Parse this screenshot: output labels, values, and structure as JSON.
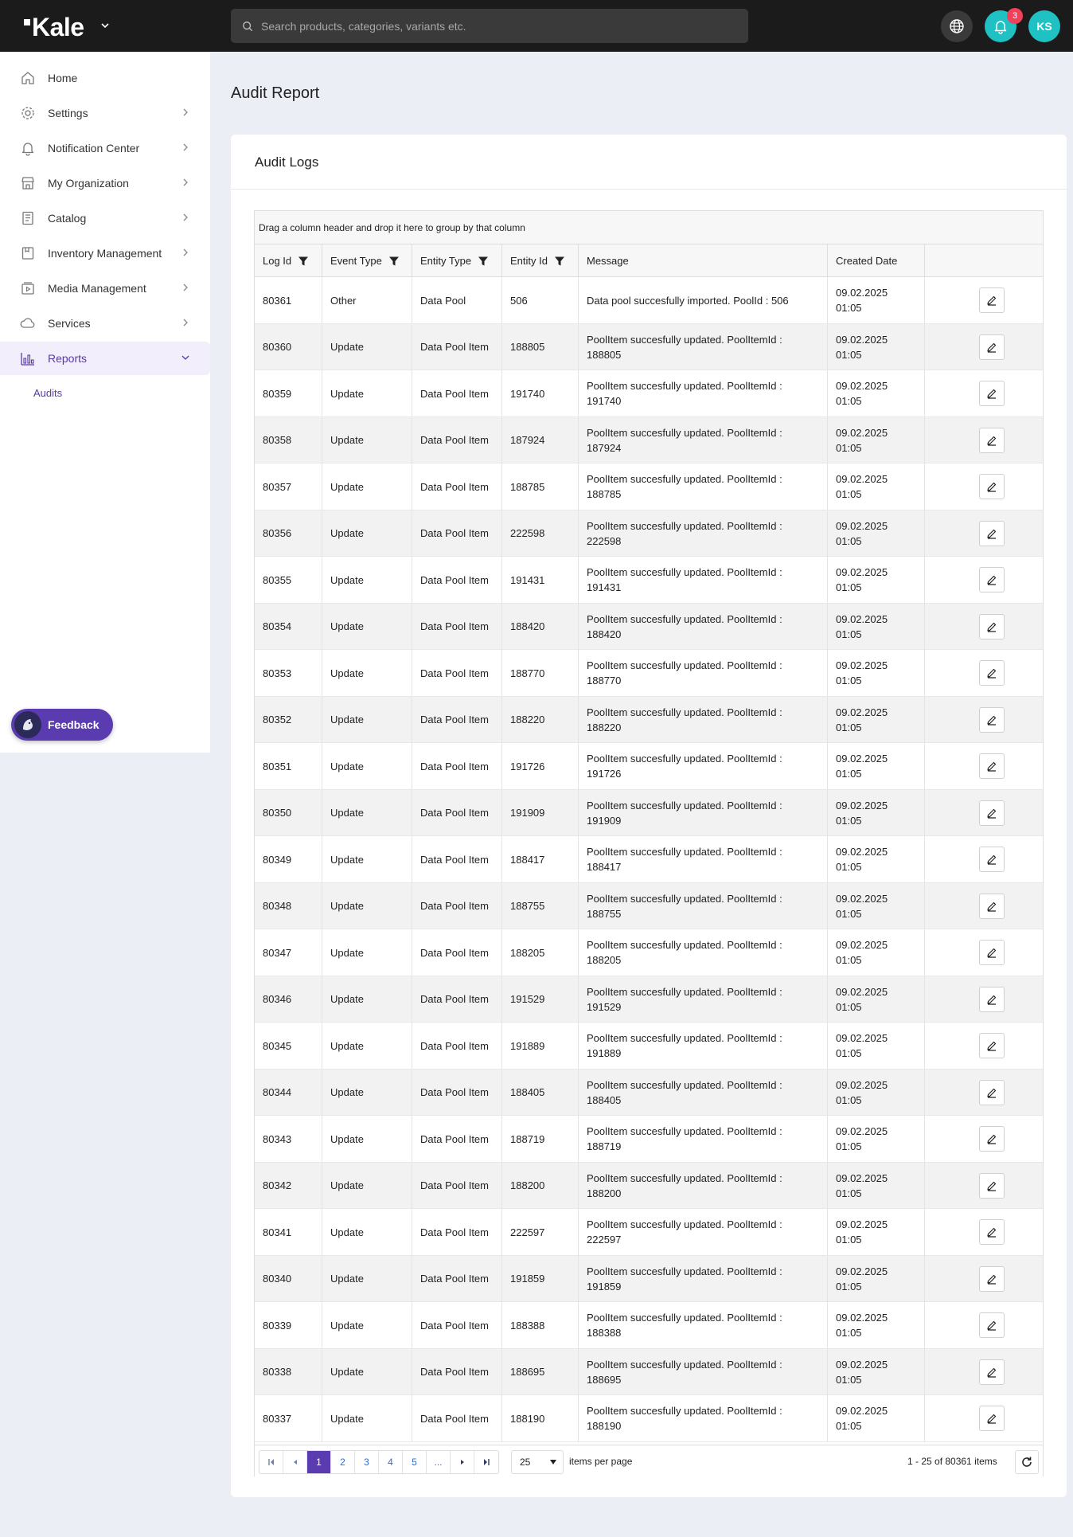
{
  "app": {
    "logo_text": "Kale"
  },
  "header": {
    "search_placeholder": "Search products, categories, variants etc.",
    "notification_count": "3",
    "user_initials": "KS"
  },
  "sidebar": {
    "items": [
      {
        "label": "Home",
        "icon": "home-icon",
        "has_chevron": false
      },
      {
        "label": "Settings",
        "icon": "gear-icon",
        "has_chevron": true
      },
      {
        "label": "Notification Center",
        "icon": "bell-icon",
        "has_chevron": true
      },
      {
        "label": "My Organization",
        "icon": "store-icon",
        "has_chevron": true
      },
      {
        "label": "Catalog",
        "icon": "catalog-icon",
        "has_chevron": true
      },
      {
        "label": "Inventory Management",
        "icon": "inventory-icon",
        "has_chevron": true
      },
      {
        "label": "Media Management",
        "icon": "media-icon",
        "has_chevron": true
      },
      {
        "label": "Services",
        "icon": "services-icon",
        "has_chevron": true
      },
      {
        "label": "Reports",
        "icon": "reports-icon",
        "has_chevron": true,
        "active": true
      }
    ],
    "sub_items": [
      {
        "label": "Audits"
      }
    ],
    "feedback_label": "Feedback"
  },
  "page": {
    "title": "Audit Report"
  },
  "card": {
    "title": "Audit Logs"
  },
  "grid": {
    "group_hint": "Drag a column header and drop it here to group by that column",
    "columns": [
      "Log Id",
      "Event Type",
      "Entity Type",
      "Entity Id",
      "Message",
      "Created Date"
    ],
    "rows": [
      {
        "log_id": "80361",
        "event": "Other",
        "entity_type": "Data Pool",
        "entity_id": "506",
        "message": "Data pool succesfully imported. PoolId : 506",
        "date": "09.02.2025 01:05"
      },
      {
        "log_id": "80360",
        "event": "Update",
        "entity_type": "Data Pool Item",
        "entity_id": "188805",
        "message": "PoolItem succesfully updated. PoolItemId : 188805",
        "date": "09.02.2025 01:05"
      },
      {
        "log_id": "80359",
        "event": "Update",
        "entity_type": "Data Pool Item",
        "entity_id": "191740",
        "message": "PoolItem succesfully updated. PoolItemId : 191740",
        "date": "09.02.2025 01:05"
      },
      {
        "log_id": "80358",
        "event": "Update",
        "entity_type": "Data Pool Item",
        "entity_id": "187924",
        "message": "PoolItem succesfully updated. PoolItemId : 187924",
        "date": "09.02.2025 01:05"
      },
      {
        "log_id": "80357",
        "event": "Update",
        "entity_type": "Data Pool Item",
        "entity_id": "188785",
        "message": "PoolItem succesfully updated. PoolItemId : 188785",
        "date": "09.02.2025 01:05"
      },
      {
        "log_id": "80356",
        "event": "Update",
        "entity_type": "Data Pool Item",
        "entity_id": "222598",
        "message": "PoolItem succesfully updated. PoolItemId : 222598",
        "date": "09.02.2025 01:05"
      },
      {
        "log_id": "80355",
        "event": "Update",
        "entity_type": "Data Pool Item",
        "entity_id": "191431",
        "message": "PoolItem succesfully updated. PoolItemId : 191431",
        "date": "09.02.2025 01:05"
      },
      {
        "log_id": "80354",
        "event": "Update",
        "entity_type": "Data Pool Item",
        "entity_id": "188420",
        "message": "PoolItem succesfully updated. PoolItemId : 188420",
        "date": "09.02.2025 01:05"
      },
      {
        "log_id": "80353",
        "event": "Update",
        "entity_type": "Data Pool Item",
        "entity_id": "188770",
        "message": "PoolItem succesfully updated. PoolItemId : 188770",
        "date": "09.02.2025 01:05"
      },
      {
        "log_id": "80352",
        "event": "Update",
        "entity_type": "Data Pool Item",
        "entity_id": "188220",
        "message": "PoolItem succesfully updated. PoolItemId : 188220",
        "date": "09.02.2025 01:05"
      },
      {
        "log_id": "80351",
        "event": "Update",
        "entity_type": "Data Pool Item",
        "entity_id": "191726",
        "message": "PoolItem succesfully updated. PoolItemId : 191726",
        "date": "09.02.2025 01:05"
      },
      {
        "log_id": "80350",
        "event": "Update",
        "entity_type": "Data Pool Item",
        "entity_id": "191909",
        "message": "PoolItem succesfully updated. PoolItemId : 191909",
        "date": "09.02.2025 01:05"
      },
      {
        "log_id": "80349",
        "event": "Update",
        "entity_type": "Data Pool Item",
        "entity_id": "188417",
        "message": "PoolItem succesfully updated. PoolItemId : 188417",
        "date": "09.02.2025 01:05"
      },
      {
        "log_id": "80348",
        "event": "Update",
        "entity_type": "Data Pool Item",
        "entity_id": "188755",
        "message": "PoolItem succesfully updated. PoolItemId : 188755",
        "date": "09.02.2025 01:05"
      },
      {
        "log_id": "80347",
        "event": "Update",
        "entity_type": "Data Pool Item",
        "entity_id": "188205",
        "message": "PoolItem succesfully updated. PoolItemId : 188205",
        "date": "09.02.2025 01:05"
      },
      {
        "log_id": "80346",
        "event": "Update",
        "entity_type": "Data Pool Item",
        "entity_id": "191529",
        "message": "PoolItem succesfully updated. PoolItemId : 191529",
        "date": "09.02.2025 01:05"
      },
      {
        "log_id": "80345",
        "event": "Update",
        "entity_type": "Data Pool Item",
        "entity_id": "191889",
        "message": "PoolItem succesfully updated. PoolItemId : 191889",
        "date": "09.02.2025 01:05"
      },
      {
        "log_id": "80344",
        "event": "Update",
        "entity_type": "Data Pool Item",
        "entity_id": "188405",
        "message": "PoolItem succesfully updated. PoolItemId : 188405",
        "date": "09.02.2025 01:05"
      },
      {
        "log_id": "80343",
        "event": "Update",
        "entity_type": "Data Pool Item",
        "entity_id": "188719",
        "message": "PoolItem succesfully updated. PoolItemId : 188719",
        "date": "09.02.2025 01:05"
      },
      {
        "log_id": "80342",
        "event": "Update",
        "entity_type": "Data Pool Item",
        "entity_id": "188200",
        "message": "PoolItem succesfully updated. PoolItemId : 188200",
        "date": "09.02.2025 01:05"
      },
      {
        "log_id": "80341",
        "event": "Update",
        "entity_type": "Data Pool Item",
        "entity_id": "222597",
        "message": "PoolItem succesfully updated. PoolItemId : 222597",
        "date": "09.02.2025 01:05"
      },
      {
        "log_id": "80340",
        "event": "Update",
        "entity_type": "Data Pool Item",
        "entity_id": "191859",
        "message": "PoolItem succesfully updated. PoolItemId : 191859",
        "date": "09.02.2025 01:05"
      },
      {
        "log_id": "80339",
        "event": "Update",
        "entity_type": "Data Pool Item",
        "entity_id": "188388",
        "message": "PoolItem succesfully updated. PoolItemId : 188388",
        "date": "09.02.2025 01:05"
      },
      {
        "log_id": "80338",
        "event": "Update",
        "entity_type": "Data Pool Item",
        "entity_id": "188695",
        "message": "PoolItem succesfully updated. PoolItemId : 188695",
        "date": "09.02.2025 01:05"
      },
      {
        "log_id": "80337",
        "event": "Update",
        "entity_type": "Data Pool Item",
        "entity_id": "188190",
        "message": "PoolItem succesfully updated. PoolItemId : 188190",
        "date": "09.02.2025 01:05"
      }
    ]
  },
  "pager": {
    "pages": [
      "1",
      "2",
      "3",
      "4",
      "5",
      "..."
    ],
    "current_page": "1",
    "page_size": "25",
    "page_size_label": "items per page",
    "info": "1 - 25 of 80361 items"
  },
  "colors": {
    "brand": "#5b3bb0",
    "accent": "#1fc1c3",
    "badge": "#f0405a",
    "topbar": "#1b1b1b"
  }
}
